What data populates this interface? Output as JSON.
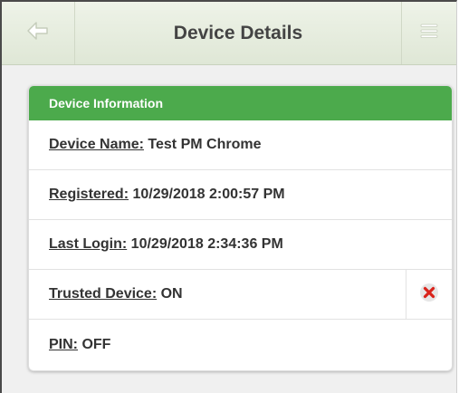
{
  "header": {
    "title": "Device Details",
    "back_icon": "arrow-left-icon",
    "menu_icon": "hamburger-menu-icon"
  },
  "card": {
    "title": "Device Information",
    "rows": [
      {
        "label": "Device Name:",
        "value": "Test PM Chrome"
      },
      {
        "label": "Registered:",
        "value": "10/29/2018 2:00:57 PM"
      },
      {
        "label": "Last Login:",
        "value": "10/29/2018 2:34:36 PM"
      },
      {
        "label": "Trusted Device:",
        "value": "ON",
        "action_icon": "remove-x-icon"
      },
      {
        "label": "PIN:",
        "value": "OFF"
      }
    ]
  },
  "colors": {
    "accent_green": "#4caa4c",
    "remove_red": "#d9231b"
  }
}
